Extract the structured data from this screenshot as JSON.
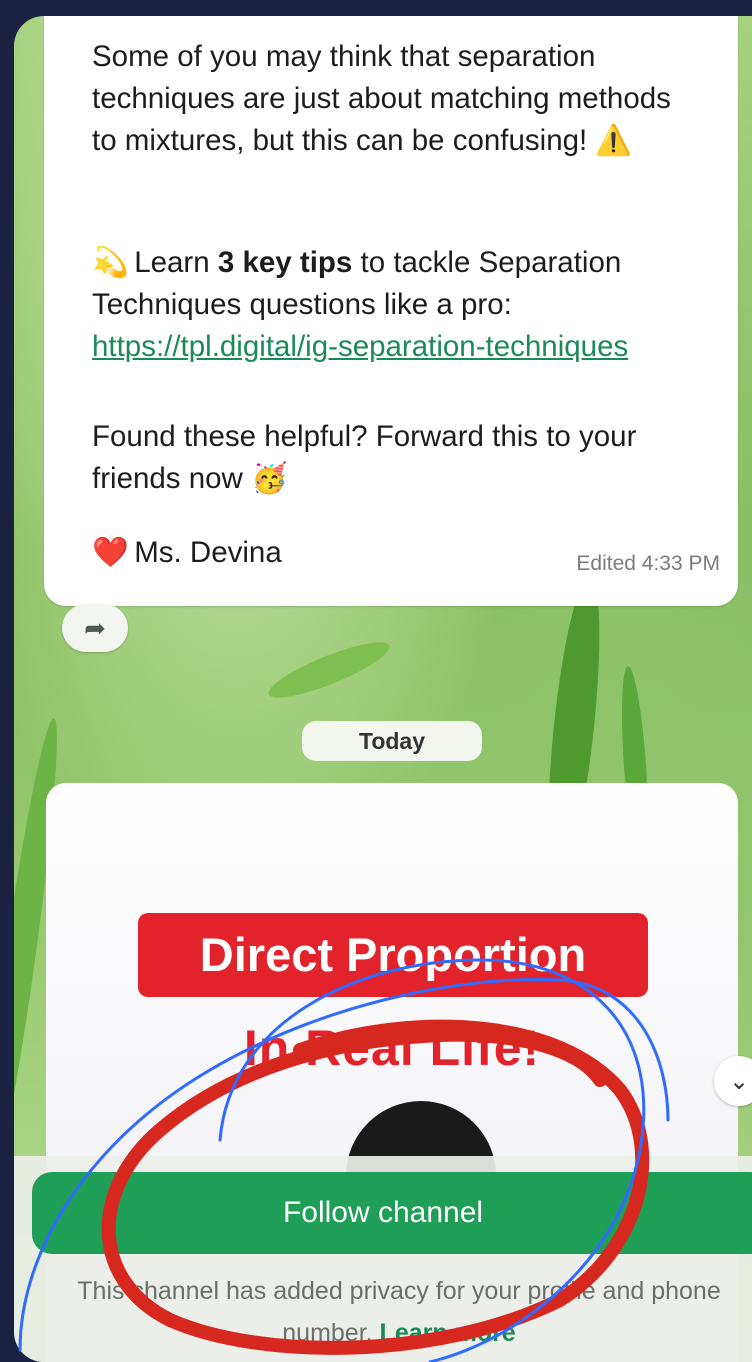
{
  "message": {
    "paragraph1": "Some of you may think that separation techniques are just about matching methods to mixtures, but this can be confusing!",
    "warning_emoji": "⚠️",
    "tips_emoji": "💫",
    "tips_prefix": "Learn ",
    "tips_bold": "3 key tips",
    "tips_suffix": " to tackle Separation Techniques questions like a pro: ",
    "link": "https://tpl.digital/ig-separation-techniques",
    "paragraph3": "Found these helpful? Forward this to your friends now",
    "party_emoji": "🥳",
    "heart_emoji": "❤️",
    "signature": "Ms. Devina",
    "edited": "Edited 4:33 PM"
  },
  "date_separator": "Today",
  "post_image": {
    "banner_text": "Direct Proportion",
    "subtitle": "In Real Life!"
  },
  "follow_button": "Follow channel",
  "privacy": {
    "text": "This channel has added privacy for your profile and phone number. ",
    "learn_more": "Learn more"
  },
  "icons": {
    "forward": "forward-arrow-icon",
    "scroll": "chevron-down-icon"
  },
  "colors": {
    "accent_green": "#1f9e58",
    "link_green": "#1b8a5a",
    "banner_red": "#e3232c",
    "annotation_red": "#d6281f",
    "annotation_blue": "#2f6bff"
  }
}
